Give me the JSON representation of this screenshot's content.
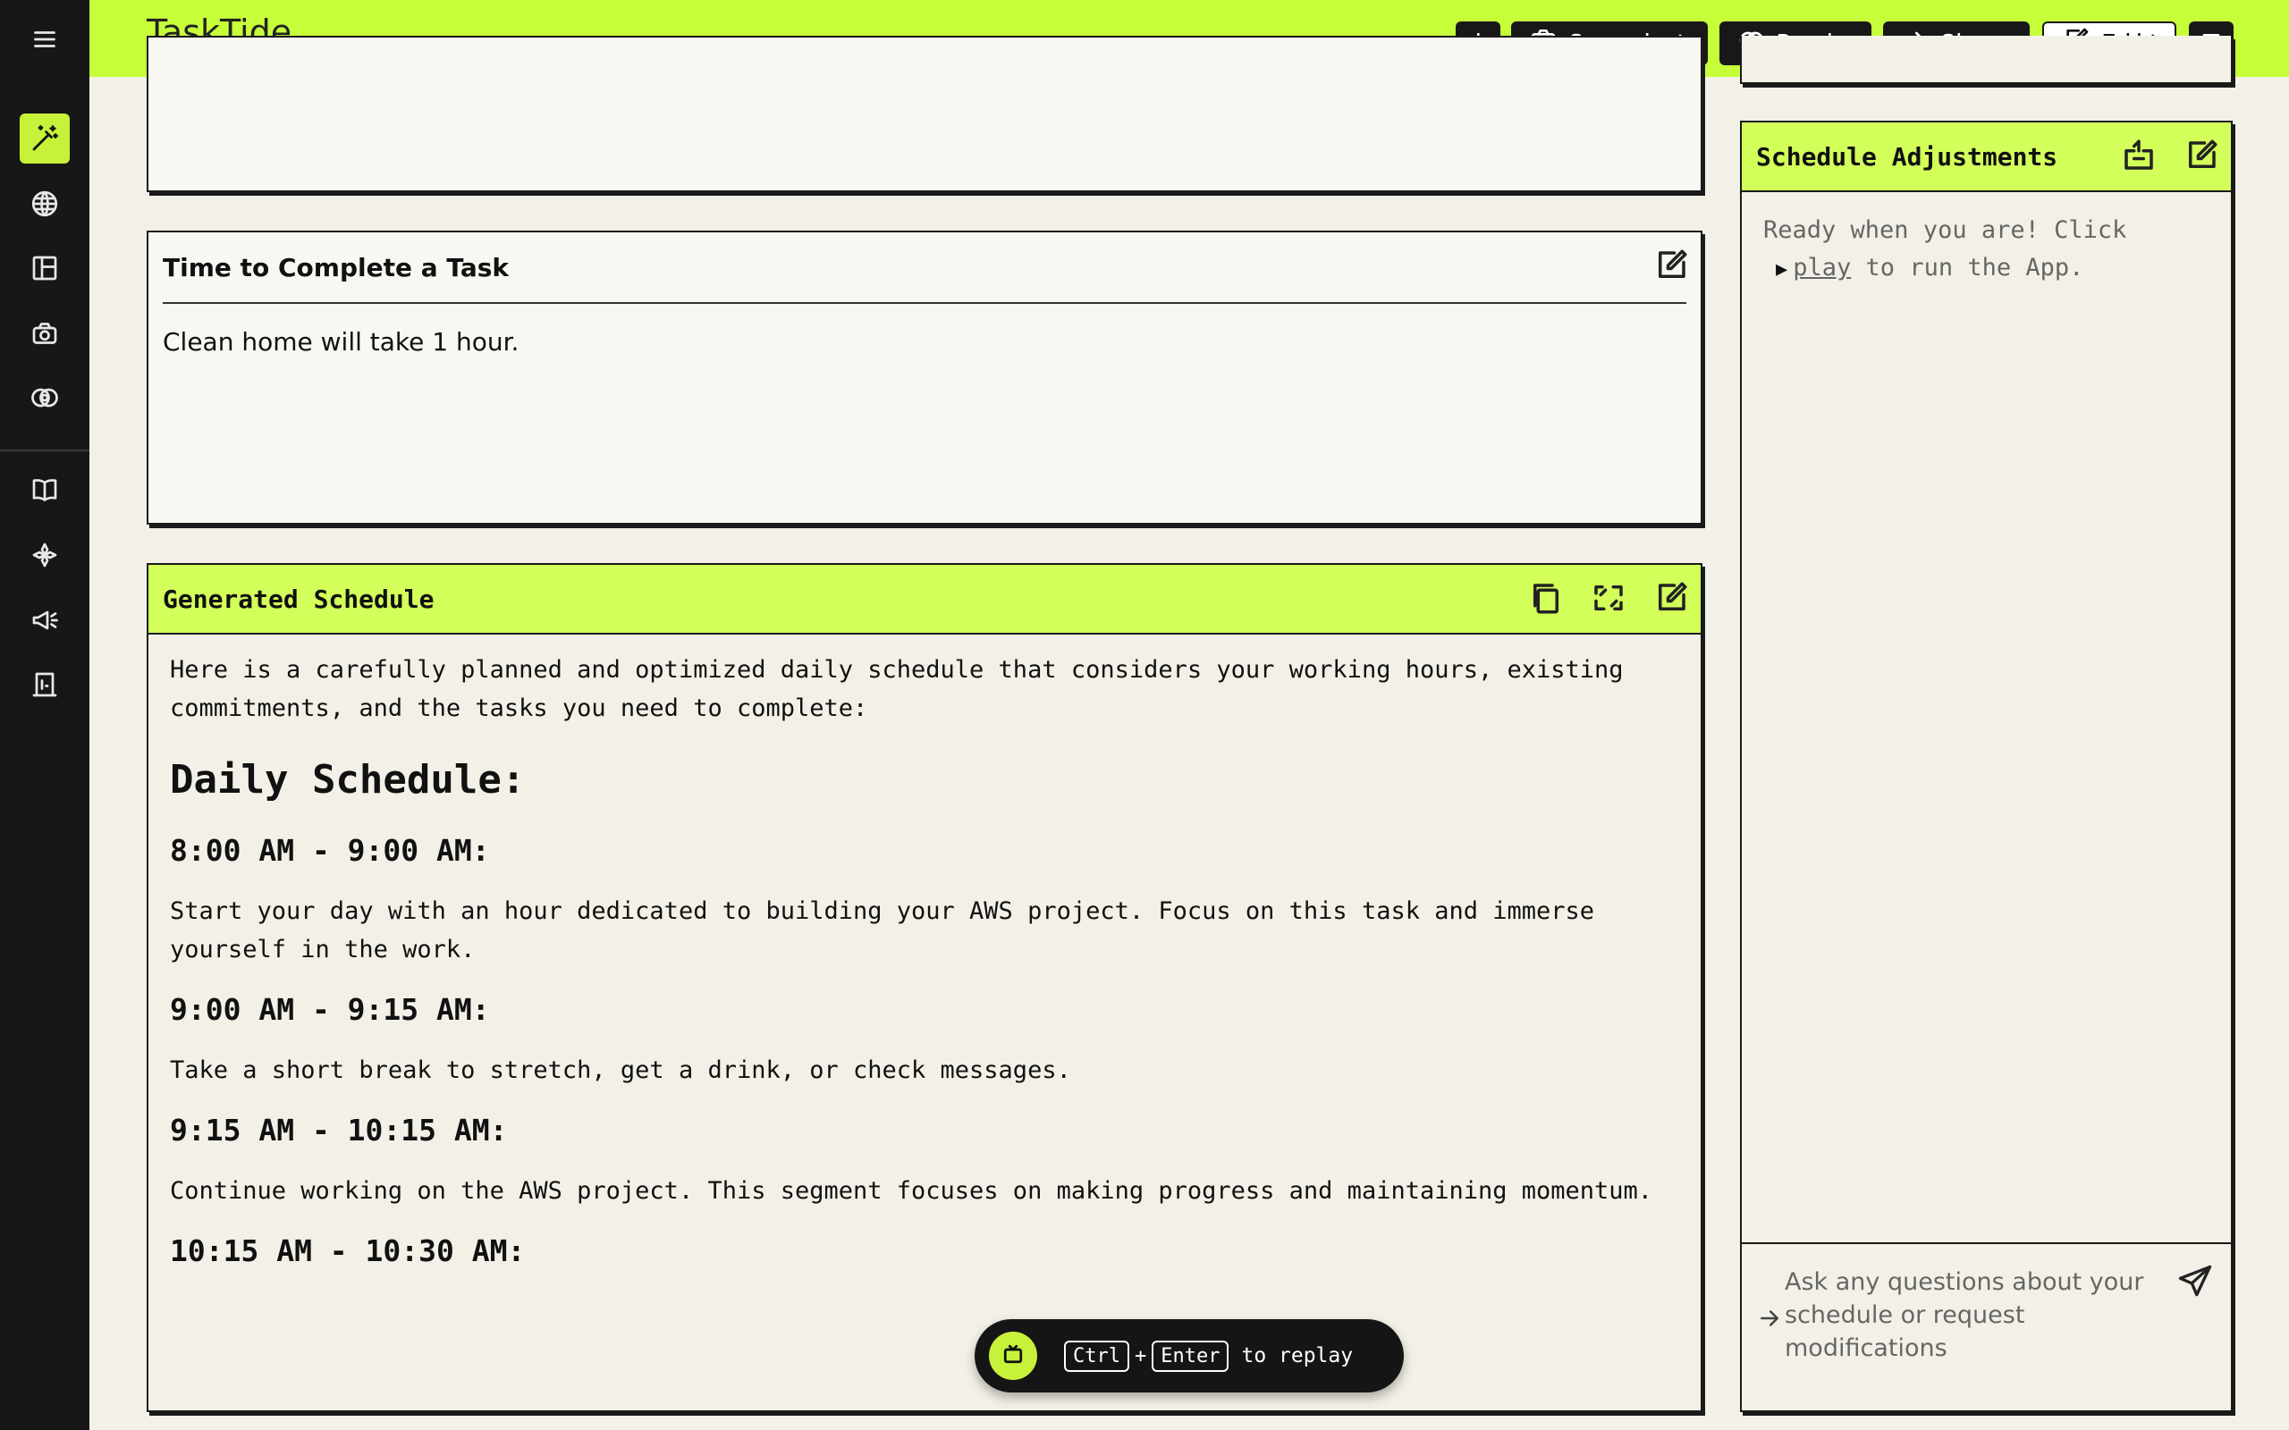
{
  "app": {
    "title": "TaskTide"
  },
  "topbar": {
    "info_label": "i",
    "snapshot_label": "Snapshot",
    "remix_label": "Remix",
    "share_label": "Share",
    "edit_label": "Edit"
  },
  "sidebar": {
    "items": [
      {
        "icon": "magic-wand-icon",
        "active": true
      },
      {
        "icon": "globe-icon"
      },
      {
        "icon": "layout-icon"
      },
      {
        "icon": "camera-icon"
      },
      {
        "icon": "remix-icon"
      },
      {
        "icon": "book-icon"
      },
      {
        "icon": "sparkles-icon"
      },
      {
        "icon": "megaphone-icon"
      },
      {
        "icon": "exit-door-icon"
      }
    ]
  },
  "time_card": {
    "title": "Time to Complete a Task",
    "content": "Clean home will take 1 hour."
  },
  "schedule_card": {
    "title": "Generated Schedule",
    "intro": "Here is a carefully planned and optimized daily schedule that considers your working hours, existing commitments, and the tasks you need to complete:",
    "heading": "Daily Schedule:",
    "blocks": [
      {
        "time": "8:00 AM - 9:00 AM:",
        "desc": "Start your day with an hour dedicated to building your AWS project. Focus on this task and immerse yourself in the work."
      },
      {
        "time": "9:00 AM - 9:15 AM:",
        "desc": "Take a short break to stretch, get a drink, or check messages."
      },
      {
        "time": "9:15 AM - 10:15 AM:",
        "desc": "Continue working on the AWS project. This segment focuses on making progress and maintaining momentum."
      },
      {
        "time": "10:15 AM - 10:30 AM:",
        "desc": ""
      }
    ]
  },
  "replay": {
    "key1": "Ctrl",
    "plus": "+",
    "key2": "Enter",
    "label": "to replay"
  },
  "adjustments": {
    "title": "Schedule Adjustments",
    "ready_line1": "Ready when you are! Click",
    "play_link": "play",
    "ready_line2_suffix": "to run the App.",
    "input_placeholder": "Ask any questions about your schedule or request modifications"
  },
  "colors": {
    "accent": "#c6ff3a",
    "header_accent": "#d3ff5a",
    "sidebar_bg": "#171717",
    "page_bg": "#f3f1e7"
  }
}
